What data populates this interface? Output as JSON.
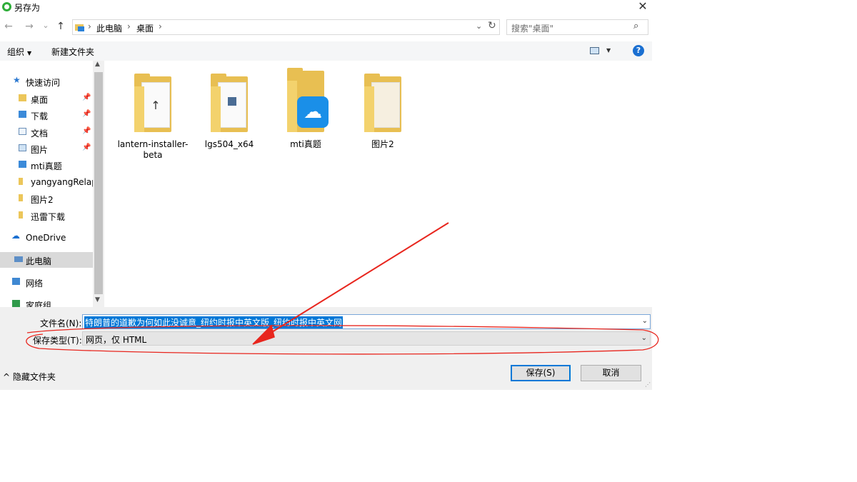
{
  "window": {
    "title": "另存为",
    "close": "✕"
  },
  "nav": {
    "back": "←",
    "forward": "→",
    "recent": "⌄",
    "up": "↑",
    "breadcrumb": [
      "此电脑",
      "桌面"
    ],
    "search_placeholder": "搜索\"桌面\""
  },
  "toolbar": {
    "organize": "组织",
    "new_folder": "新建文件夹",
    "help": "?"
  },
  "sidebar": {
    "items": [
      {
        "label": "快速访问",
        "icon": "star-icon",
        "pinned": false
      },
      {
        "label": "桌面",
        "icon": "desktop-icon",
        "pinned": true
      },
      {
        "label": "下载",
        "icon": "download-icon",
        "pinned": true
      },
      {
        "label": "文档",
        "icon": "document-icon",
        "pinned": true
      },
      {
        "label": "图片",
        "icon": "picture-icon",
        "pinned": true
      },
      {
        "label": "mti真题",
        "icon": "folder-icon",
        "pinned": false
      },
      {
        "label": "yangyangRelap",
        "icon": "folder-icon",
        "pinned": false
      },
      {
        "label": "图片2",
        "icon": "folder-icon",
        "pinned": false
      },
      {
        "label": "迅雷下载",
        "icon": "folder-icon",
        "pinned": false
      },
      {
        "label": "OneDrive",
        "icon": "onedrive-icon",
        "pinned": false
      },
      {
        "label": "此电脑",
        "icon": "computer-icon",
        "pinned": false,
        "selected": true
      },
      {
        "label": "网络",
        "icon": "network-icon",
        "pinned": false
      },
      {
        "label": "家庭组",
        "icon": "homegroup-icon",
        "pinned": false
      }
    ]
  },
  "files": [
    {
      "name": "lantern-installer-beta",
      "icon": "folder-icon"
    },
    {
      "name": "lgs504_x64",
      "icon": "folder-icon"
    },
    {
      "name": "mti真题",
      "icon": "folder-icon"
    },
    {
      "name": "图片2",
      "icon": "folder-icon"
    }
  ],
  "form": {
    "filename_label": "文件名(N):",
    "filename_value": "特朗普的道歉为何如此没诚意_纽约时报中英文版_纽约时报中英文网",
    "type_label": "保存类型(T):",
    "type_value": "网页，仅 HTML",
    "hide_folders": "隐藏文件夹",
    "save": "保存(S)",
    "cancel": "取消"
  },
  "colors": {
    "accent": "#0078d7",
    "annotation": "#e8261e"
  }
}
